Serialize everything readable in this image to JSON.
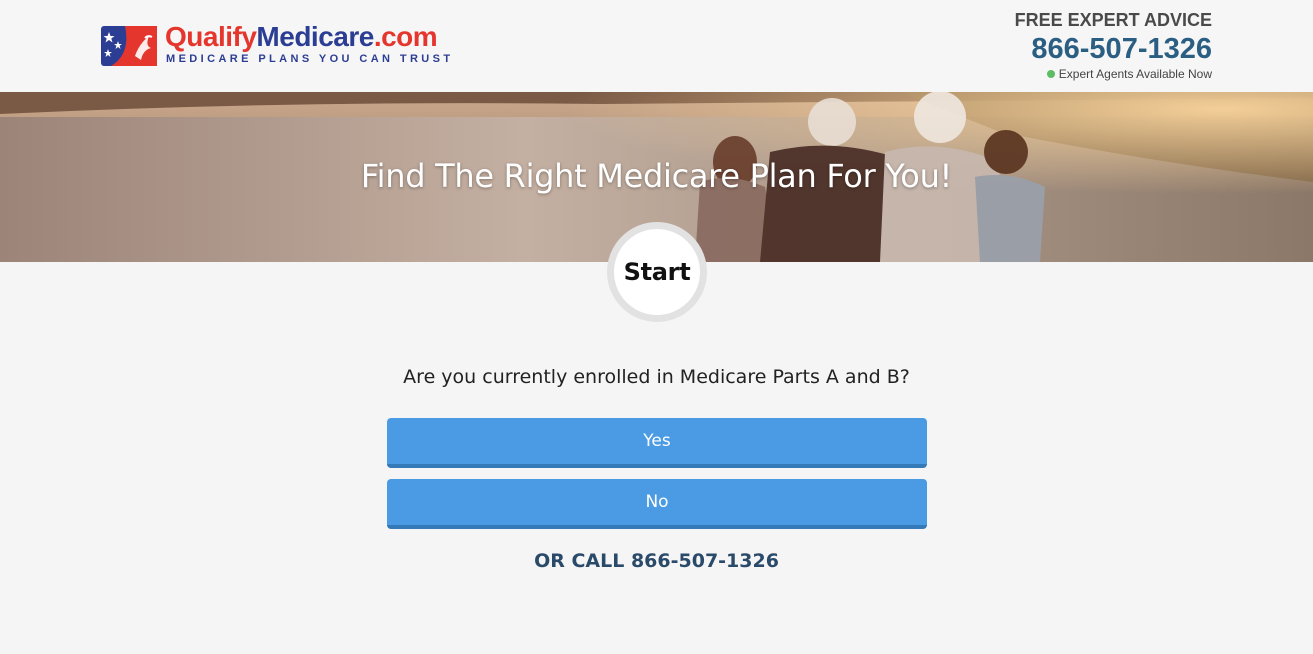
{
  "header": {
    "logo": {
      "wordmark_qualify": "Qualify",
      "wordmark_medicare": "Medicare",
      "wordmark_dotcom": ".com",
      "tagline": "MEDICARE PLANS YOU CAN TRUST",
      "icon": "flag-eagle-logo-icon"
    },
    "advice": {
      "title": "FREE EXPERT ADVICE",
      "phone": "866-507-1326",
      "status": "Expert Agents Available Now",
      "status_color": "#5cbd62"
    }
  },
  "hero": {
    "title": "Find The Right Medicare Plan For You!"
  },
  "step": {
    "label": "Start"
  },
  "form": {
    "question": "Are you currently enrolled in Medicare Parts A and B?",
    "answers": [
      {
        "label": "Yes"
      },
      {
        "label": "No"
      }
    ],
    "call_prefix": "OR CALL",
    "call_phone": "866-507-1326"
  },
  "colors": {
    "brand_red": "#e5362e",
    "brand_blue": "#2c3e94",
    "phone_blue": "#2b5e83",
    "button_blue": "#4a9be3",
    "call_text": "#2a4a6a"
  }
}
